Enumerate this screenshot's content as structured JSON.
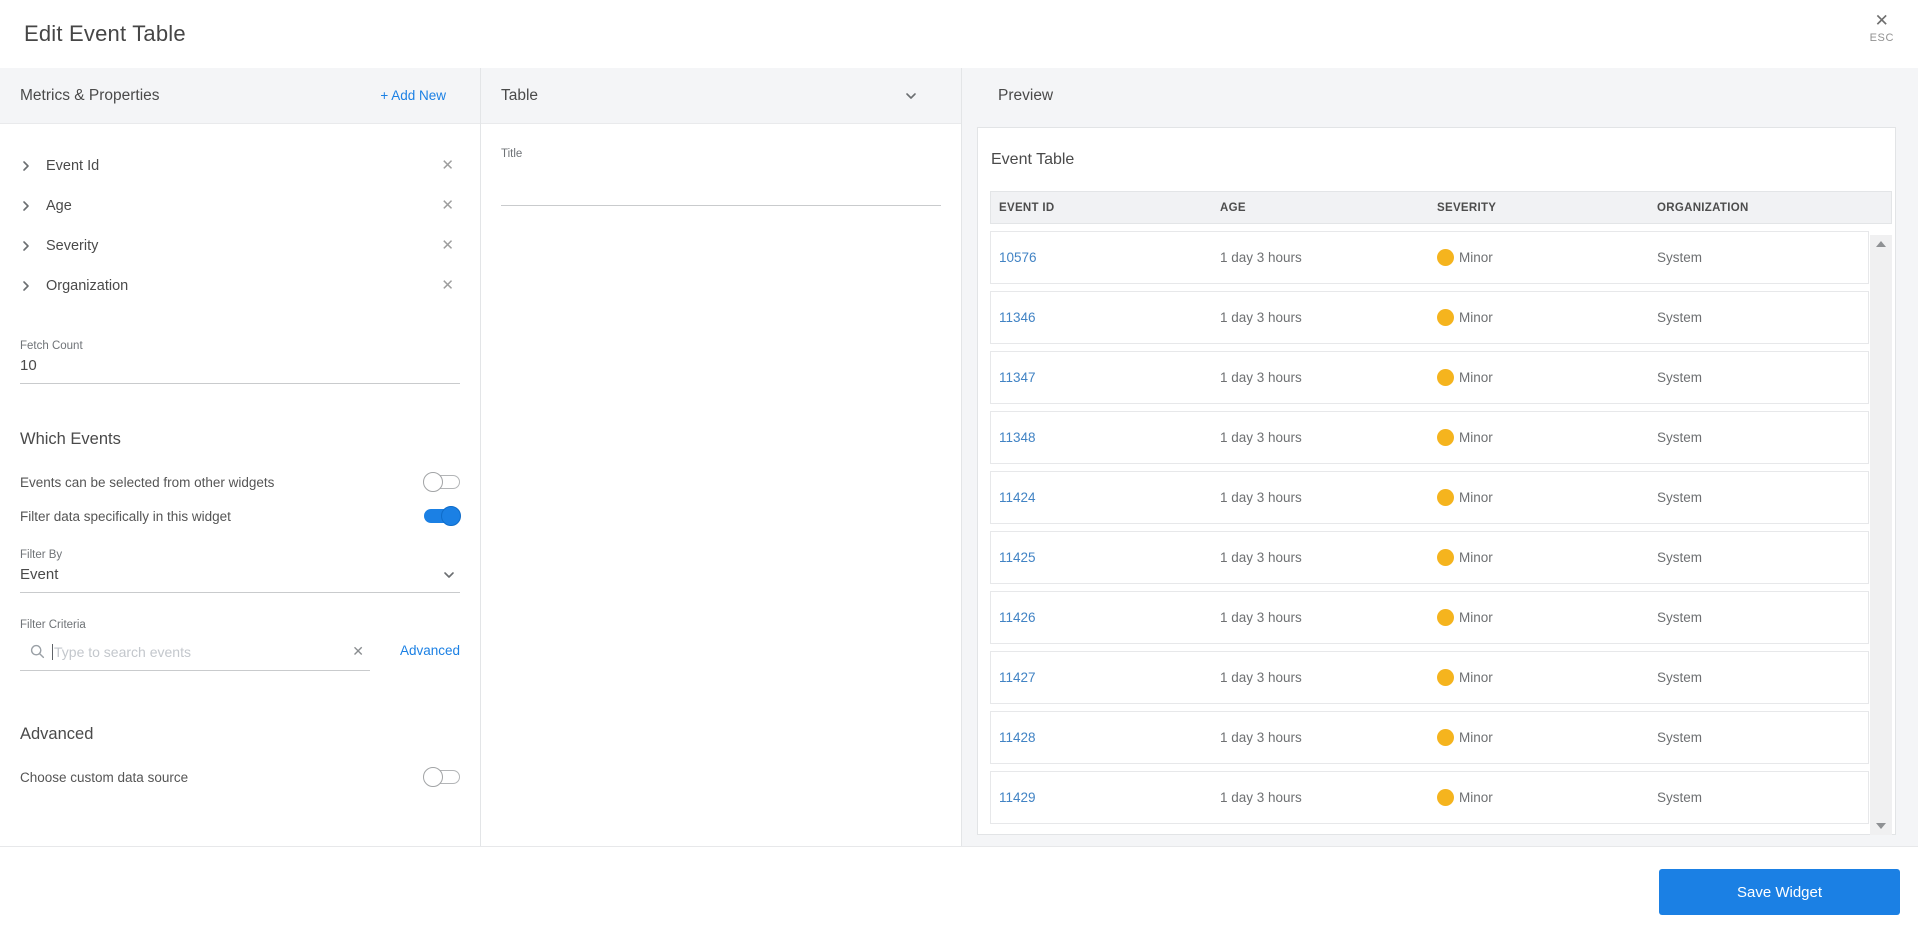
{
  "colors": {
    "accent_blue": "#1b80e4",
    "link_blue": "#4183c4",
    "severity_minor": "#f5b41e"
  },
  "icons": {
    "close": "✕",
    "remove": "✕",
    "clear": "✕"
  },
  "header": {
    "title": "Edit Event Table",
    "esc_label": "ESC"
  },
  "metrics_panel": {
    "title": "Metrics & Properties",
    "add_new_label": "+ Add New",
    "properties": [
      {
        "label": "Event Id"
      },
      {
        "label": "Age"
      },
      {
        "label": "Severity"
      },
      {
        "label": "Organization"
      }
    ],
    "fetch_count": {
      "label": "Fetch Count",
      "value": "10"
    },
    "which_events": {
      "heading": "Which Events",
      "toggles": [
        {
          "label": "Events can be selected from other widgets",
          "on": false
        },
        {
          "label": "Filter data specifically in this widget",
          "on": true
        }
      ]
    },
    "filter_by": {
      "label": "Filter By",
      "value": "Event"
    },
    "filter_criteria": {
      "label": "Filter Criteria",
      "placeholder": "Type to search events",
      "advanced_link": "Advanced"
    },
    "advanced": {
      "heading": "Advanced",
      "toggle_label": "Choose custom data source",
      "on": false
    }
  },
  "table_panel": {
    "title": "Table",
    "fields": {
      "title_label": "Title",
      "title_value": ""
    }
  },
  "preview_panel": {
    "title": "Preview",
    "card_title": "Event Table",
    "columns": [
      {
        "label": "EVENT ID"
      },
      {
        "label": "AGE"
      },
      {
        "label": "SEVERITY"
      },
      {
        "label": "ORGANIZATION"
      }
    ],
    "rows": [
      {
        "event_id": "10576",
        "age": "1 day 3 hours",
        "severity": "Minor",
        "organization": "System"
      },
      {
        "event_id": "11346",
        "age": "1 day 3 hours",
        "severity": "Minor",
        "organization": "System"
      },
      {
        "event_id": "11347",
        "age": "1 day 3 hours",
        "severity": "Minor",
        "organization": "System"
      },
      {
        "event_id": "11348",
        "age": "1 day 3 hours",
        "severity": "Minor",
        "organization": "System"
      },
      {
        "event_id": "11424",
        "age": "1 day 3 hours",
        "severity": "Minor",
        "organization": "System"
      },
      {
        "event_id": "11425",
        "age": "1 day 3 hours",
        "severity": "Minor",
        "organization": "System"
      },
      {
        "event_id": "11426",
        "age": "1 day 3 hours",
        "severity": "Minor",
        "organization": "System"
      },
      {
        "event_id": "11427",
        "age": "1 day 3 hours",
        "severity": "Minor",
        "organization": "System"
      },
      {
        "event_id": "11428",
        "age": "1 day 3 hours",
        "severity": "Minor",
        "organization": "System"
      },
      {
        "event_id": "11429",
        "age": "1 day 3 hours",
        "severity": "Minor",
        "organization": "System"
      }
    ]
  },
  "footer": {
    "save_label": "Save Widget"
  }
}
